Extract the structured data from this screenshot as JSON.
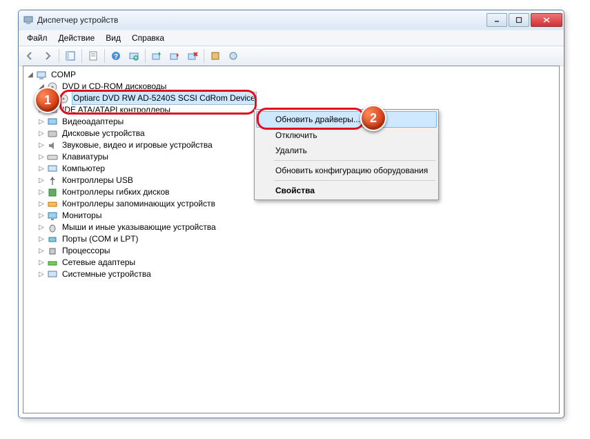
{
  "window": {
    "title": "Диспетчер устройств"
  },
  "menu": {
    "file": "Файл",
    "action": "Действие",
    "view": "Вид",
    "help": "Справка"
  },
  "tree": {
    "root": "COMP",
    "cat_dvd": "DVD и CD-ROM дисководы",
    "dev_optiarc": "Optiarc DVD RW AD-5240S SCSI CdRom Device",
    "cat_ide": "IDE ATA/ATAPI контроллеры",
    "cat_video": "Видеоадаптеры",
    "cat_disk": "Дисковые устройства",
    "cat_sound": "Звуковые, видео и игровые устройства",
    "cat_keyboard": "Клавиатуры",
    "cat_computer": "Компьютер",
    "cat_usb": "Контроллеры USB",
    "cat_floppy": "Контроллеры гибких дисков",
    "cat_storage": "Контроллеры запоминающих устройств",
    "cat_monitor": "Мониторы",
    "cat_mouse": "Мыши и иные указывающие устройства",
    "cat_ports": "Порты (COM и LPT)",
    "cat_cpu": "Процессоры",
    "cat_net": "Сетевые адаптеры",
    "cat_system": "Системные устройства"
  },
  "context": {
    "update": "Обновить драйверы...",
    "disable": "Отключить",
    "delete": "Удалить",
    "scan": "Обновить конфигурацию оборудования",
    "props": "Свойства"
  },
  "badge1": "1",
  "badge2": "2"
}
